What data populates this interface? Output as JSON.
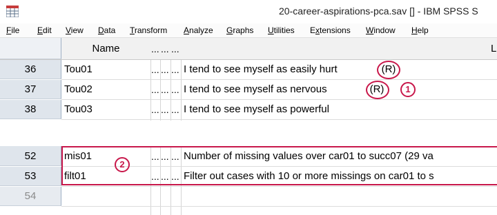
{
  "window": {
    "title": "20-career-aspirations-pca.sav [] - IBM SPSS S"
  },
  "menu": {
    "items": [
      {
        "label": "File",
        "mn": "F",
        "rest": "ile"
      },
      {
        "label": "Edit",
        "mn": "E",
        "rest": "dit"
      },
      {
        "label": "View",
        "mn": "V",
        "rest": "iew"
      },
      {
        "label": "Data",
        "mn": "D",
        "rest": "ata"
      },
      {
        "label": "Transform",
        "mn": "T",
        "rest": "ransform"
      },
      {
        "label": "Analyze",
        "mn": "A",
        "rest": "nalyze"
      },
      {
        "label": "Graphs",
        "mn": "G",
        "rest": "raphs"
      },
      {
        "label": "Utilities",
        "mn": "U",
        "rest": "tilities"
      },
      {
        "label": "Extensions",
        "mn": "x",
        "pre": "E",
        "rest": "tensions"
      },
      {
        "label": "Window",
        "mn": "W",
        "rest": "indow"
      },
      {
        "label": "Help",
        "mn": "H",
        "rest": "elp"
      }
    ]
  },
  "grid": {
    "header": {
      "name": "Name",
      "c1": "...",
      "c2": "...",
      "c3": "...",
      "last": "L"
    },
    "dots": "...",
    "rows_top": [
      {
        "num": "36",
        "name": "Tou01",
        "label": "I tend to see myself as easily hurt",
        "suffix": "(R)"
      },
      {
        "num": "37",
        "name": "Tou02",
        "label": "I tend to see myself as nervous",
        "suffix": "(R)"
      },
      {
        "num": "38",
        "name": "Tou03",
        "label": "I tend to see myself as powerful",
        "suffix": ""
      }
    ],
    "rows_bottom": [
      {
        "num": "52",
        "name": "mis01",
        "label": "Number of missing values over car01 to succ07 (29 va"
      },
      {
        "num": "53",
        "name": "filt01",
        "label": "Filter out cases with 10 or more missings on car01 to s"
      },
      {
        "num": "54",
        "name": "",
        "label": ""
      }
    ]
  },
  "annotations": {
    "badge1": "1",
    "badge2": "2"
  },
  "colors": {
    "accent": "#c8174a",
    "row_header": "#dfe5ec"
  }
}
